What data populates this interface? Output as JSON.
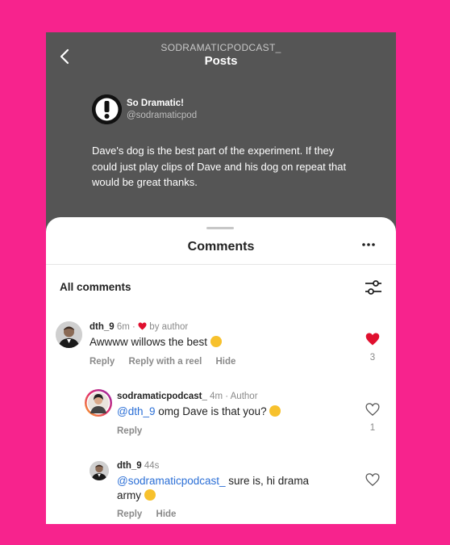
{
  "header": {
    "username": "SODRAMATICPODCAST_",
    "title": "Posts"
  },
  "post": {
    "author_name": "So Dramatic!",
    "author_handle": "@sodramaticpod",
    "text": "Dave's dog is the best part of the experiment. If they could just play clips of Dave and his dog on repeat that would be great thanks."
  },
  "sheet": {
    "title": "Comments",
    "section_label": "All comments"
  },
  "comments": [
    {
      "username": "dth_9",
      "time": "6m",
      "badge": "by author",
      "text": "Awwww willows the best",
      "actions": [
        "Reply",
        "Reply with a reel",
        "Hide"
      ],
      "likes": "3",
      "liked": true
    },
    {
      "username": "sodramaticpodcast_",
      "time": "4m",
      "badge": "Author",
      "mention": "@dth_9",
      "text": " omg Dave is that you?",
      "actions": [
        "Reply"
      ],
      "likes": "1",
      "liked": false
    },
    {
      "username": "dth_9",
      "time": "44s",
      "mention": "@sodramaticpodcast_",
      "text": " sure is, hi drama army",
      "actions": [
        "Reply",
        "Hide"
      ],
      "likes": "",
      "liked": false
    }
  ],
  "colors": {
    "background": "#f7238d",
    "liked_heart": "#e0102f",
    "mention": "#2b6fd6"
  }
}
